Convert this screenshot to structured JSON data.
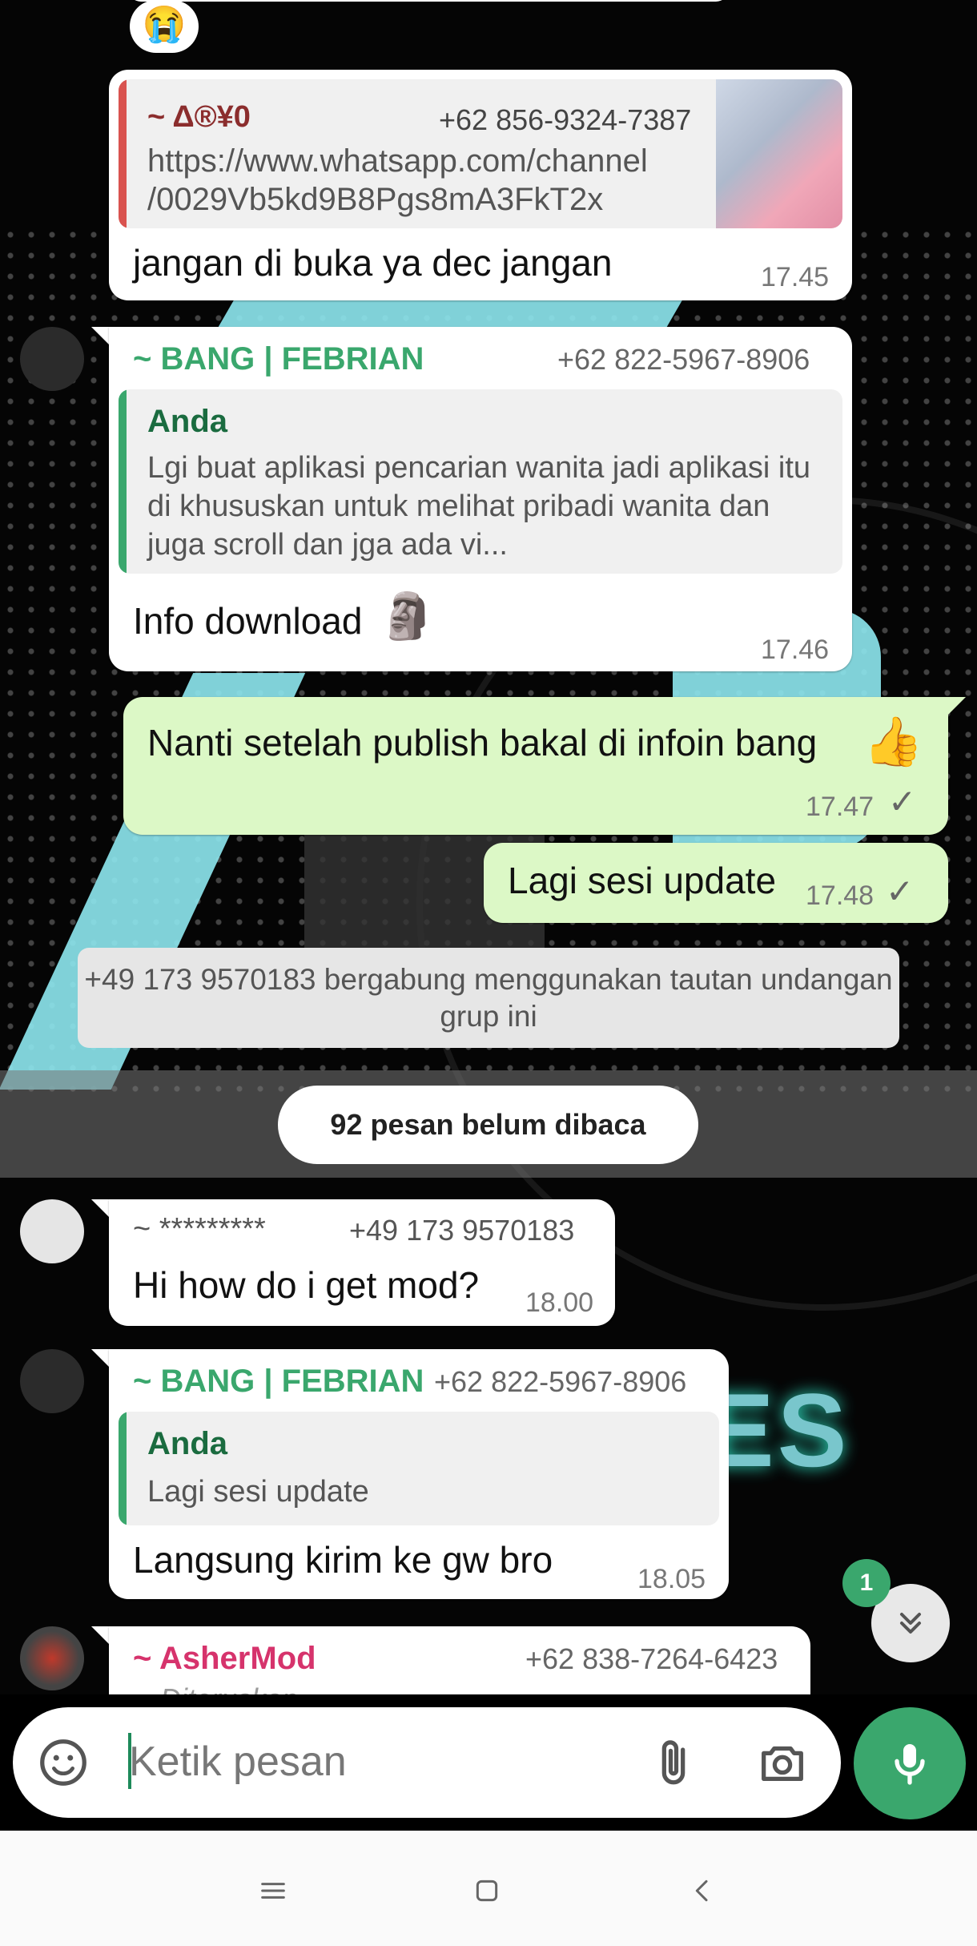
{
  "messages": {
    "forwarded_channel": {
      "sender": "~ Δ®¥0",
      "phone": "+62 856-9324-7387",
      "link_line1": "https://www.whatsapp.com/channel",
      "link_line2": "/0029Vb5kd9B8Pgs8mA3FkT2x",
      "text": "jangan di buka ya dec jangan",
      "time": "17.45",
      "reaction": "😭"
    },
    "febrian_1": {
      "sender": "~ BANG | FEBRIAN",
      "phone": "+62 822-5967-8906",
      "quote_name": "Anda",
      "quote_text": "Lgi buat aplikasi pencarian wanita jadi aplikasi itu di khususkan untuk melihat pribadi wanita dan juga scroll dan jga ada vi...",
      "text": "Info download",
      "emoji": "🗿",
      "time": "17.46"
    },
    "out_1": {
      "text": "Nanti setelah publish bakal di infoin bang",
      "emoji": "👍",
      "time": "17.47",
      "tick": "✓"
    },
    "out_2": {
      "text": "Lagi sesi update",
      "time": "17.48",
      "tick": "✓"
    },
    "system": "+49 173 9570183 bergabung menggunakan tautan undangan grup ini",
    "unread": "92 pesan belum dibaca",
    "unknown": {
      "sender": "~ *********",
      "phone": "+49 173 9570183",
      "text": "Hi how do i get mod?",
      "time": "18.00"
    },
    "febrian_2": {
      "sender": "~ BANG | FEBRIAN",
      "phone": "+62 822-5967-8906",
      "quote_name": "Anda",
      "quote_text": "Lagi sesi update",
      "text": "Langsung kirim ke gw bro",
      "time": "18.05"
    },
    "ashermod": {
      "sender": "~ AsherMod",
      "phone": "+62 838-7264-6423",
      "partial": "» Diteruskan"
    }
  },
  "scroll_badge": "1",
  "composer": {
    "placeholder": "Ketik pesan",
    "icons": [
      "sticker-icon",
      "paperclip-icon",
      "camera-icon",
      "microphone-icon"
    ]
  },
  "navbar": {
    "icons": [
      "menu-icon",
      "home-icon",
      "back-icon"
    ]
  },
  "colors": {
    "accent_green": "#3aa76d",
    "outgoing_bubble": "#dcf8c6",
    "sender_febrian": "#3aa76d",
    "sender_delta": "#8b2d2d",
    "sender_ashermod": "#d6336c"
  }
}
